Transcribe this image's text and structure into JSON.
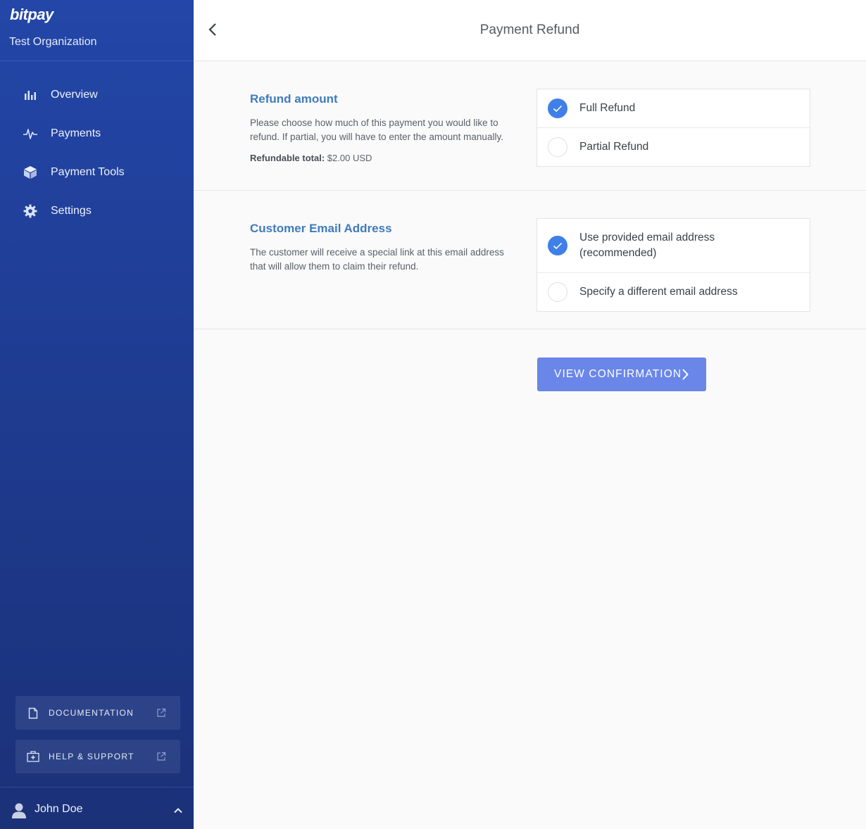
{
  "sidebar": {
    "brand": "bitpay",
    "organization": "Test Organization",
    "nav": [
      {
        "label": "Overview",
        "icon": "bar-chart-icon"
      },
      {
        "label": "Payments",
        "icon": "pulse-icon"
      },
      {
        "label": "Payment Tools",
        "icon": "cube-icon"
      },
      {
        "label": "Settings",
        "icon": "gear-icon"
      }
    ],
    "documentation_label": "DOCUMENTATION",
    "help_label": "HELP & SUPPORT",
    "user_name": "John Doe"
  },
  "header": {
    "title": "Payment Refund"
  },
  "refund_section": {
    "title": "Refund amount",
    "description": "Please choose how much of this payment you would like to refund. If partial, you will have to enter the amount manually.",
    "total_label": "Refundable total:",
    "total_value": "$2.00 USD",
    "options": [
      {
        "label": "Full Refund",
        "selected": true
      },
      {
        "label": "Partial Refund",
        "selected": false
      }
    ]
  },
  "email_section": {
    "title": "Customer Email Address",
    "description": "The customer will receive a special link at this email address that will allow them to claim their refund.",
    "options": [
      {
        "label": "Use provided email address (recommended)",
        "selected": true
      },
      {
        "label": "Specify a different email address",
        "selected": false
      }
    ]
  },
  "actions": {
    "view_confirmation_label": "VIEW CONFIRMATION"
  },
  "colors": {
    "sidebar_top": "#2346a8",
    "sidebar_bottom": "#1b3178",
    "accent_blue": "#3f7fe8",
    "section_title": "#3f7bbd",
    "cta": "#6a86e8"
  }
}
